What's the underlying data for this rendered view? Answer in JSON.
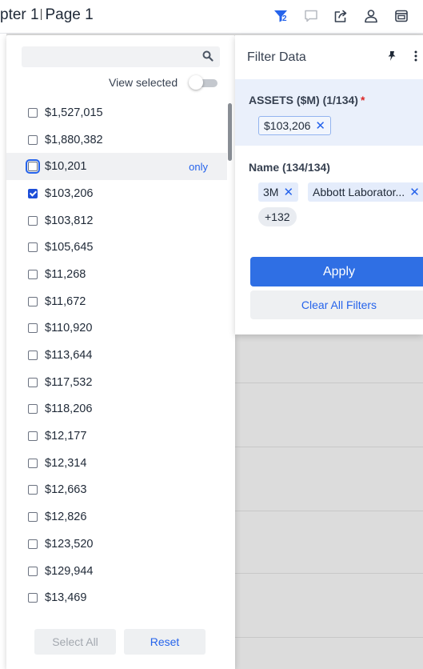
{
  "header": {
    "breadcrumb_part1": "pter 1",
    "breadcrumb_sep": "|",
    "breadcrumb_part2": "Page 1",
    "filter_badge": "2",
    "icons": [
      "filter-icon",
      "comment-icon",
      "share-icon",
      "user-icon",
      "present-icon"
    ]
  },
  "list": {
    "search": {
      "value": "",
      "placeholder": ""
    },
    "view_selected_label": "View selected",
    "view_selected_on": false,
    "only_label": "only",
    "items": [
      {
        "label": "$1,527,015",
        "checked": false
      },
      {
        "label": "$1,880,382",
        "checked": false
      },
      {
        "label": "$10,201",
        "checked": false,
        "hover": true
      },
      {
        "label": "$103,206",
        "checked": true
      },
      {
        "label": "$103,812",
        "checked": false
      },
      {
        "label": "$105,645",
        "checked": false
      },
      {
        "label": "$11,268",
        "checked": false
      },
      {
        "label": "$11,672",
        "checked": false
      },
      {
        "label": "$110,920",
        "checked": false
      },
      {
        "label": "$113,644",
        "checked": false
      },
      {
        "label": "$117,532",
        "checked": false
      },
      {
        "label": "$118,206",
        "checked": false
      },
      {
        "label": "$12,177",
        "checked": false
      },
      {
        "label": "$12,314",
        "checked": false
      },
      {
        "label": "$12,663",
        "checked": false
      },
      {
        "label": "$12,826",
        "checked": false
      },
      {
        "label": "$123,520",
        "checked": false
      },
      {
        "label": "$129,944",
        "checked": false
      },
      {
        "label": "$13,469",
        "checked": false
      }
    ],
    "select_all_label": "Select All",
    "reset_label": "Reset"
  },
  "filter_panel": {
    "title": "Filter Data",
    "assets_title": "ASSETS ($M) (1/134)",
    "assets_required": "*",
    "assets_chip": "$103,206",
    "name_title": "Name (134/134)",
    "name_chips": [
      "3M",
      "Abbott Laborator..."
    ],
    "name_more": "+132",
    "apply_label": "Apply",
    "clear_label": "Clear All Filters"
  },
  "colors": {
    "accent": "#2563eb",
    "apply_button": "#2f6fe4",
    "required": "#dc2626",
    "assets_section_bg": "#eaf0fb"
  }
}
